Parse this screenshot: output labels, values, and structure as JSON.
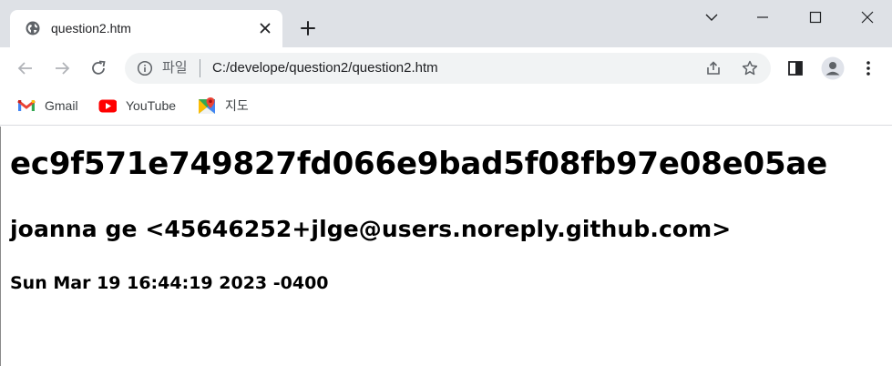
{
  "browser": {
    "tab": {
      "title": "question2.htm"
    },
    "omnibox": {
      "scheme_label": "파일",
      "separator": "|",
      "url": "C:/develope/question2/question2.htm"
    },
    "bookmarks": [
      {
        "label": "Gmail",
        "icon": "gmail-icon"
      },
      {
        "label": "YouTube",
        "icon": "youtube-icon"
      },
      {
        "label": "지도",
        "icon": "maps-icon"
      }
    ],
    "colors": {
      "tabstrip": "#dee1e6",
      "omnibox": "#f1f3f4",
      "icon": "#5f6368"
    }
  },
  "page": {
    "hash": "ec9f571e749827fd066e9bad5f08fb97e08e05ae",
    "author": "joanna ge <45646252+jlge@users.noreply.github.com>",
    "date": "Sun Mar 19 16:44:19 2023 -0400"
  }
}
